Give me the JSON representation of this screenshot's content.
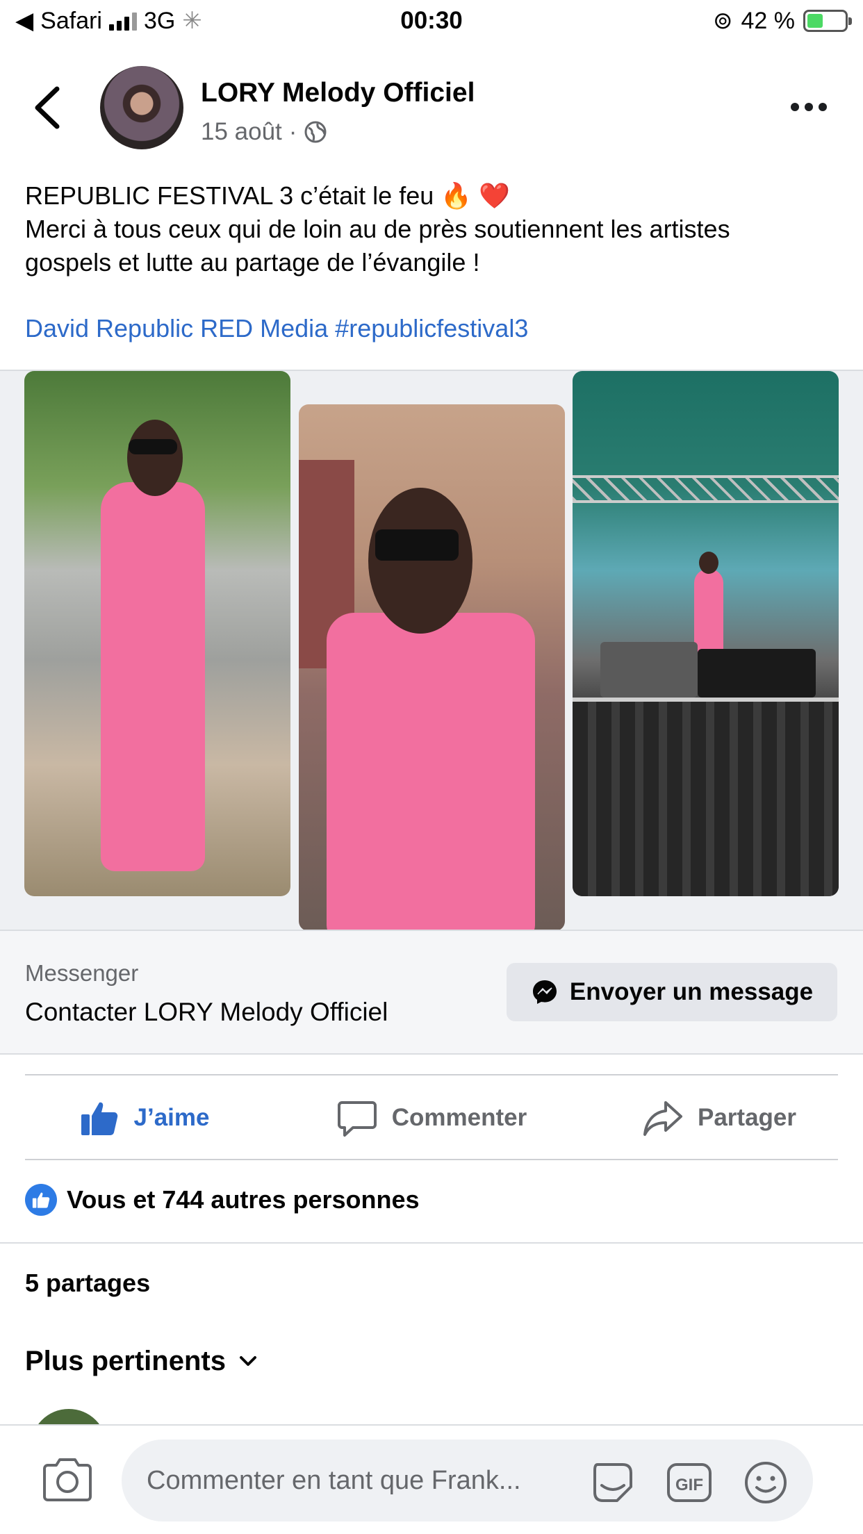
{
  "status_bar": {
    "carrier": "Safari",
    "network": "3G",
    "time": "00:30",
    "battery": "42 %",
    "battery_level": 0.42
  },
  "post": {
    "page_name": "LORY Melody Officiel",
    "date": "15 août",
    "separator": "·",
    "text_lines": [
      "REPUBLIC FESTIVAL 3 c’était le feu 🔥 ❤️",
      "Merci à tous ceux qui de loin au de près soutiennent les artistes",
      "gospels et lutte au partage de l’évangile !"
    ],
    "links": "David Republic RED Media #republicfestival3"
  },
  "messenger": {
    "label": "Messenger",
    "contact": "Contacter LORY Melody Officiel",
    "button": "Envoyer un message"
  },
  "actions": {
    "like": "J’aime",
    "comment": "Commenter",
    "share": "Partager"
  },
  "reactions": {
    "summary": "Vous et 744 autres personnes"
  },
  "shares": "5 partages",
  "sort": "Plus pertinents",
  "comment_bar": {
    "placeholder": "Commenter en tant que Frank..."
  },
  "colors": {
    "link_blue": "#2d6ac9",
    "like_blue": "#2d7be5",
    "battery_green": "#4cd964"
  }
}
